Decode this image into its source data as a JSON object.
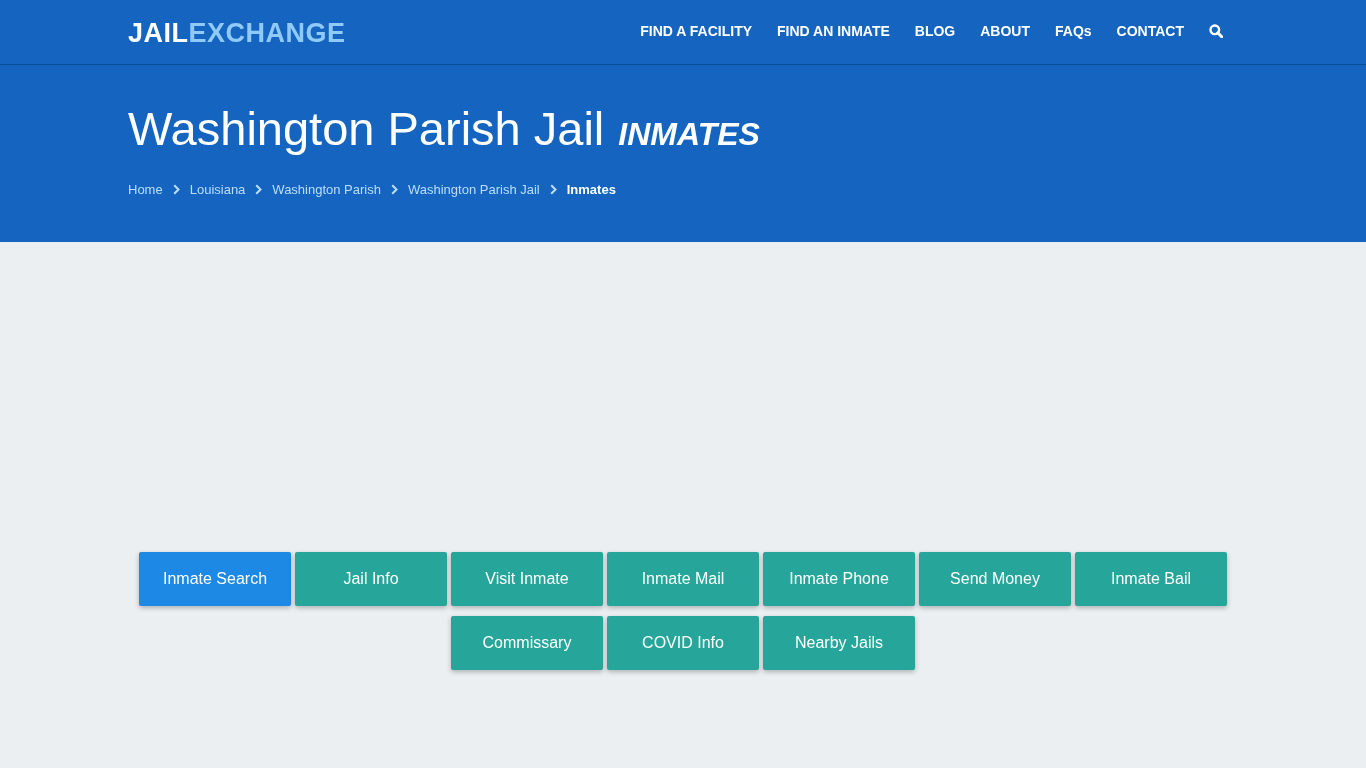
{
  "header": {
    "logo": {
      "part_1": "JAIL",
      "part_2": "EXCHANGE"
    },
    "nav": [
      "FIND A FACILITY",
      "FIND AN INMATE",
      "BLOG",
      "ABOUT",
      "FAQs",
      "CONTACT"
    ]
  },
  "hero": {
    "title": "Washington Parish Jail",
    "subtitle": "INMATES",
    "breadcrumb": [
      {
        "label": "Home",
        "current": false
      },
      {
        "label": "Louisiana",
        "current": false
      },
      {
        "label": "Washington Parish",
        "current": false
      },
      {
        "label": "Washington Parish Jail",
        "current": false
      },
      {
        "label": "Inmates",
        "current": true
      }
    ]
  },
  "buttons": [
    {
      "label": "Inmate Search",
      "selected": true
    },
    {
      "label": "Jail Info",
      "selected": false
    },
    {
      "label": "Visit Inmate",
      "selected": false
    },
    {
      "label": "Inmate Mail",
      "selected": false
    },
    {
      "label": "Inmate Phone",
      "selected": false
    },
    {
      "label": "Send Money",
      "selected": false
    },
    {
      "label": "Inmate Bail",
      "selected": false
    },
    {
      "label": "Commissary",
      "selected": false
    },
    {
      "label": "COVID Info",
      "selected": false
    },
    {
      "label": "Nearby Jails",
      "selected": false
    }
  ]
}
